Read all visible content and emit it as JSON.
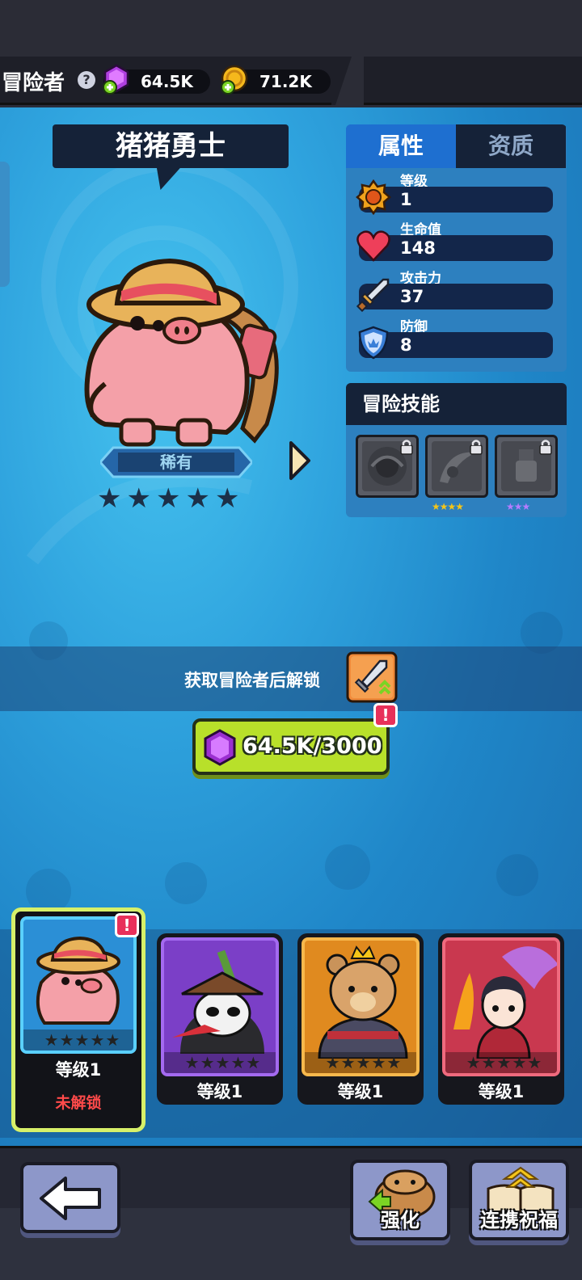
{
  "header": {
    "title": "冒险者",
    "help_glyph": "?",
    "gems": "64.5K",
    "coins": "71.2K"
  },
  "hero": {
    "name": "猪猪勇士",
    "rarity": "稀有",
    "stars_total": 5,
    "stars_filled": 0
  },
  "tabs": {
    "attributes": "属性",
    "aptitude": "资质"
  },
  "stats": [
    {
      "label": "等级",
      "value": "1",
      "icon": "level-badge-icon"
    },
    {
      "label": "生命值",
      "value": "148",
      "icon": "heart-icon"
    },
    {
      "label": "攻击力",
      "value": "37",
      "icon": "sword-icon"
    },
    {
      "label": "防御",
      "value": "8",
      "icon": "shield-icon"
    }
  ],
  "skills": {
    "title": "冒险技能",
    "items": [
      {
        "icon": "skill-1-icon",
        "locked": true,
        "stars": ""
      },
      {
        "icon": "skill-2-icon",
        "locked": true,
        "stars": "★★★★",
        "star_color": "#f5c518"
      },
      {
        "icon": "skill-3-icon",
        "locked": true,
        "stars": "★★★",
        "star_color": "#b57cff"
      }
    ]
  },
  "unlock": {
    "text": "获取冒险者后解锁",
    "cost": "64.5K/3000",
    "alert": "!"
  },
  "roster": [
    {
      "level": "等级1",
      "status": "未解锁",
      "selected": true,
      "alert": "!",
      "bg": "#2b8fd6",
      "border": "#5ad0ff"
    },
    {
      "level": "等级1",
      "status": "",
      "selected": false,
      "bg": "#7b3fc7",
      "border": "#a46af0"
    },
    {
      "level": "等级1",
      "status": "",
      "selected": false,
      "bg": "#e08a1f",
      "border": "#f7b84c"
    },
    {
      "level": "等级1",
      "status": "",
      "selected": false,
      "bg": "#c9384f",
      "border": "#ef6a7e"
    }
  ],
  "roster_stars": "★★★★★",
  "bottom": {
    "enhance": "强化",
    "blessing": "连携祝福"
  }
}
